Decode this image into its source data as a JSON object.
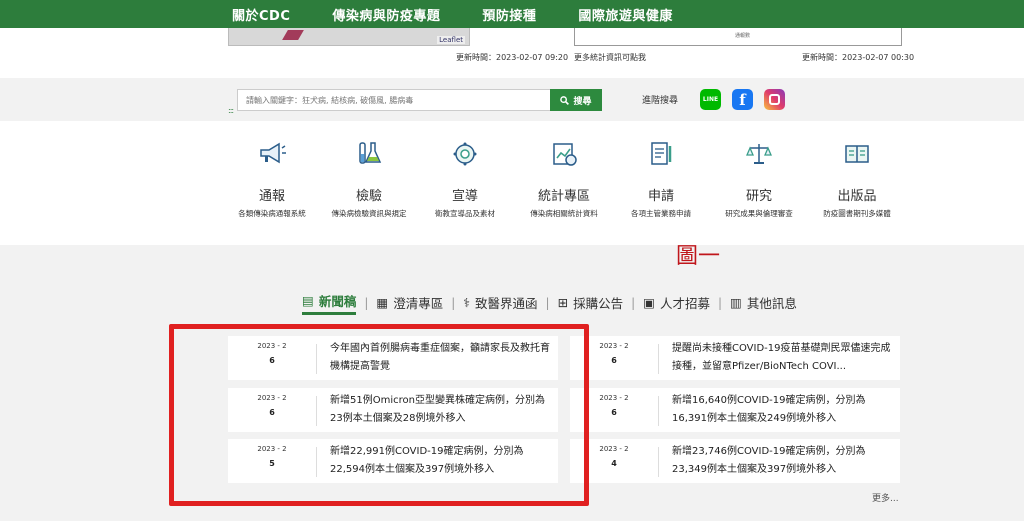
{
  "nav": {
    "items": [
      "關於CDC",
      "傳染病與防疫專題",
      "預防接種",
      "國際旅遊與健康"
    ]
  },
  "top_panels": {
    "map_attribution": "Leaflet",
    "chart_caption": "通報數",
    "left_update": "更新時間：2023-02-07 09:20",
    "right_note": "更多統計資訊可點我",
    "right_update": "更新時間：2023-02-07 00:30"
  },
  "search": {
    "placeholder": "請輸入關鍵字：狂犬病, 結核病, 破傷風, 腸病毒",
    "button_label": "搜尋",
    "advanced": "進階搜尋",
    "line_label": "LINE",
    "fb_label": "f"
  },
  "services": [
    {
      "title": "通報",
      "desc": "各類傳染病通報系統",
      "icon": "megaphone-icon"
    },
    {
      "title": "檢驗",
      "desc": "傳染病檢驗資訊與規定",
      "icon": "test-tube-icon"
    },
    {
      "title": "宣導",
      "desc": "衛教宣導品及素材",
      "icon": "virus-icon"
    },
    {
      "title": "統計專區",
      "desc": "傳染病相關統計資料",
      "icon": "chart-icon"
    },
    {
      "title": "申請",
      "desc": "各項主管業務申請",
      "icon": "form-icon"
    },
    {
      "title": "研究",
      "desc": "研究成果與倫理審查",
      "icon": "scale-icon"
    },
    {
      "title": "出版品",
      "desc": "防疫圖書期刊多媒體",
      "icon": "book-icon"
    }
  ],
  "annotation": "圖一",
  "tabs": [
    "新聞稿",
    "澄清專區",
    "致醫界通函",
    "採購公告",
    "人才招募",
    "其他訊息"
  ],
  "news": [
    {
      "ym": "2023 - 2",
      "day": "6",
      "text": "今年國內首例腸病毒重症個案，籲請家長及教托育機構提高警覺"
    },
    {
      "ym": "2023 - 2",
      "day": "6",
      "text": "提醒尚未接種COVID-19疫苗基礎劑民眾儘速完成接種，並留意Pfizer/BioNTech COVI..."
    },
    {
      "ym": "2023 - 2",
      "day": "6",
      "text": "新增51例Omicron亞型變異株確定病例，分別為23例本土個案及28例境外移入"
    },
    {
      "ym": "2023 - 2",
      "day": "6",
      "text": "新增16,640例COVID-19確定病例，分別為16,391例本土個案及249例境外移入"
    },
    {
      "ym": "2023 - 2",
      "day": "5",
      "text": "新增22,991例COVID-19確定病例，分別為22,594例本土個案及397例境外移入"
    },
    {
      "ym": "2023 - 2",
      "day": "4",
      "text": "新增23,746例COVID-19確定病例，分別為23,349例本土個案及397例境外移入"
    }
  ],
  "more": "更多..."
}
